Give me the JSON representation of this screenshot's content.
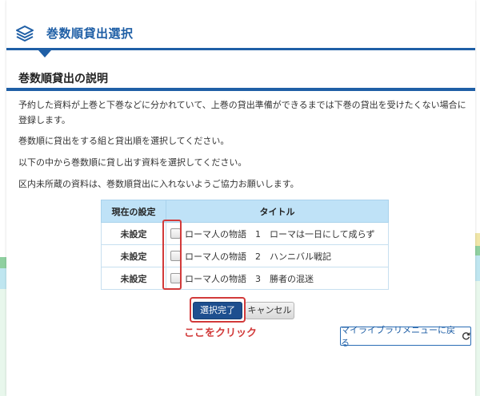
{
  "page": {
    "title": "巻数順貸出選択",
    "icon": "layers-icon"
  },
  "section": {
    "title": "巻数順貸出の説明"
  },
  "description": [
    "予約した資料が上巻と下巻などに分かれていて、上巻の貸出準備ができるまでは下巻の貸出を受けたくない場合に登録します。",
    "巻数順に貸出をする組と貸出順を選択してください。",
    "以下の中から巻数順に貸し出す資料を選択してください。",
    "区内未所蔵の資料は、巻数順貸出に入れないようご協力お願いします。"
  ],
  "table": {
    "headers": [
      "現在の設定",
      "タイトル"
    ],
    "rows": [
      {
        "status": "未設定",
        "title": "ローマ人の物語　1　ローマは一日にして成らず",
        "checked": false
      },
      {
        "status": "未設定",
        "title": "ローマ人の物語　2　ハンニバル戦記",
        "checked": false
      },
      {
        "status": "未設定",
        "title": "ローマ人の物語　3　勝者の混迷",
        "checked": false
      }
    ]
  },
  "buttons": {
    "done": "選択完了",
    "cancel": "キャンセル",
    "back": "マイライブラリメニューに戻る"
  },
  "annotation": {
    "click_note": "ここをクリック",
    "color": "#d23a3a"
  },
  "colors": {
    "accent": "#1f5fa6",
    "table_header": "#bfe2f7",
    "primary_button": "#1e4f8f"
  }
}
